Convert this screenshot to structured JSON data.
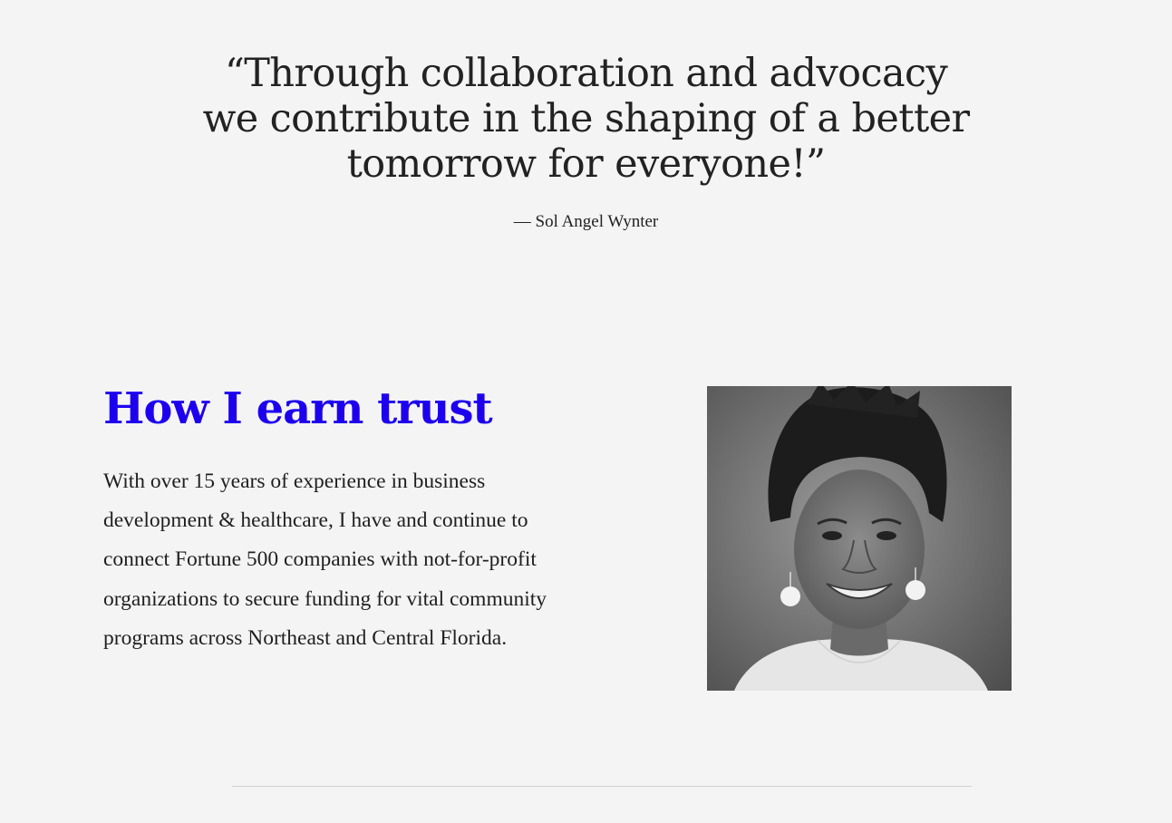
{
  "quote": {
    "text": "“Through collaboration and advocacy we contribute in the shaping of a better tomorrow for everyone!”",
    "author": "— Sol Angel Wynter"
  },
  "trust": {
    "heading": "How I earn trust",
    "body": "With over 15 years of experience in business development & healthcare, I have and continue to connect Fortune 500 companies with not-for-profit organizations to secure funding for vital community programs across Northeast and Central Florida."
  },
  "colors": {
    "background": "#f4f4f4",
    "heading_accent": "#1d00ee",
    "text": "#1f1f1f"
  },
  "portrait": {
    "icon": "portrait-photo"
  }
}
